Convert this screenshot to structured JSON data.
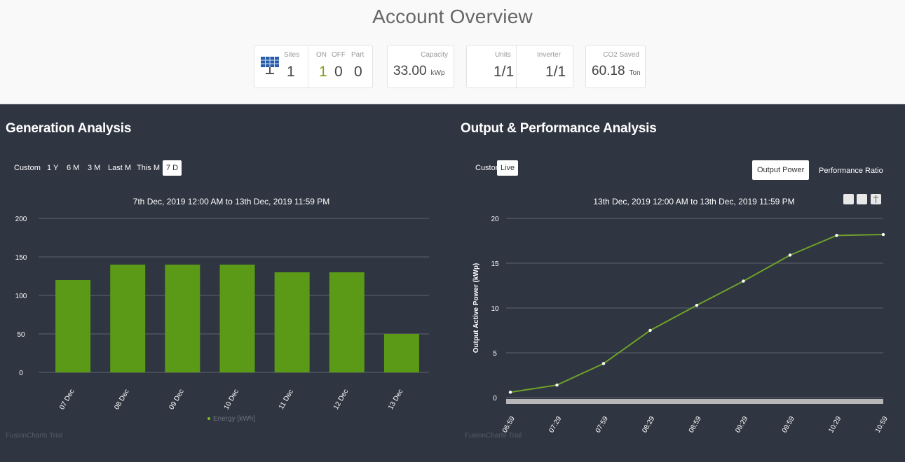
{
  "header": {
    "title": "Account Overview",
    "sites": {
      "label": "Sites",
      "value": "1"
    },
    "on": {
      "label": "ON",
      "value": "1"
    },
    "off": {
      "label": "OFF",
      "value": "0"
    },
    "part": {
      "label": "Part",
      "value": "0"
    },
    "capacity": {
      "label": "Capacity",
      "value": "33.00",
      "unit": "kWp"
    },
    "units": {
      "label": "Units",
      "value": "1/1"
    },
    "inverter": {
      "label": "Inverter",
      "value": "1/1"
    },
    "co2": {
      "label": "CO2 Saved",
      "value": "60.18",
      "unit": "Ton"
    },
    "icon": "solar-panel-icon",
    "green_color": "#8a9a16"
  },
  "generation": {
    "title": "Generation Analysis",
    "tabs": [
      {
        "label": "Custom",
        "active": false
      },
      {
        "label": "1 Y",
        "active": false
      },
      {
        "label": "6 M",
        "active": false
      },
      {
        "label": "3 M",
        "active": false
      },
      {
        "label": "Last M",
        "active": false
      },
      {
        "label": "This M",
        "active": false
      },
      {
        "label": "7 D",
        "active": true
      }
    ],
    "caption": "7th Dec, 2019 12:00 AM to 13th Dec, 2019 11:59 PM",
    "legend": "Energy [kWh]",
    "trial": "FusionCharts Trial"
  },
  "output": {
    "title": "Output & Performance Analysis",
    "tabs": [
      {
        "label": "Custom",
        "active": false
      },
      {
        "label": "Live",
        "active": true
      }
    ],
    "right_tabs": [
      {
        "label": "Output Power",
        "active": true
      },
      {
        "label": "Performance Ratio",
        "active": false
      }
    ],
    "caption": "13th Dec, 2019 12:00 AM to 13th Dec, 2019 11:59 PM",
    "trial": "FusionCharts Trial"
  },
  "chart_data": [
    {
      "type": "bar",
      "categories": [
        "07 Dec",
        "08 Dec",
        "09 Dec",
        "10 Dec",
        "11 Dec",
        "12 Dec",
        "13 Dec"
      ],
      "series": [
        {
          "name": "Energy [kWh]",
          "values": [
            120,
            140,
            140,
            140,
            130,
            130,
            50
          ]
        }
      ],
      "title": "7th Dec, 2019 12:00 AM to 13th Dec, 2019 11:59 PM",
      "xlabel": "",
      "ylabel": "",
      "ylim": [
        0,
        200
      ],
      "yticks": [
        0,
        50,
        100,
        150,
        200
      ],
      "grid": true,
      "legend": "bottom-center",
      "color": "#5a9a16"
    },
    {
      "type": "line",
      "x": [
        "06:59",
        "07:29",
        "07:59",
        "08:29",
        "08:59",
        "09:29",
        "09:59",
        "10:29",
        "10:59"
      ],
      "series": [
        {
          "values": [
            0.6,
            1.4,
            3.8,
            7.5,
            10.3,
            13.0,
            15.9,
            18.1,
            18.2
          ]
        }
      ],
      "title": "13th Dec, 2019 12:00 AM to 13th Dec, 2019 11:59 PM",
      "xlabel": "",
      "ylabel": "Output Active Power (kWp)",
      "ylim": [
        0,
        20
      ],
      "yticks": [
        0,
        5,
        10,
        15,
        20
      ],
      "grid": true,
      "color": "#6fa12a"
    }
  ]
}
